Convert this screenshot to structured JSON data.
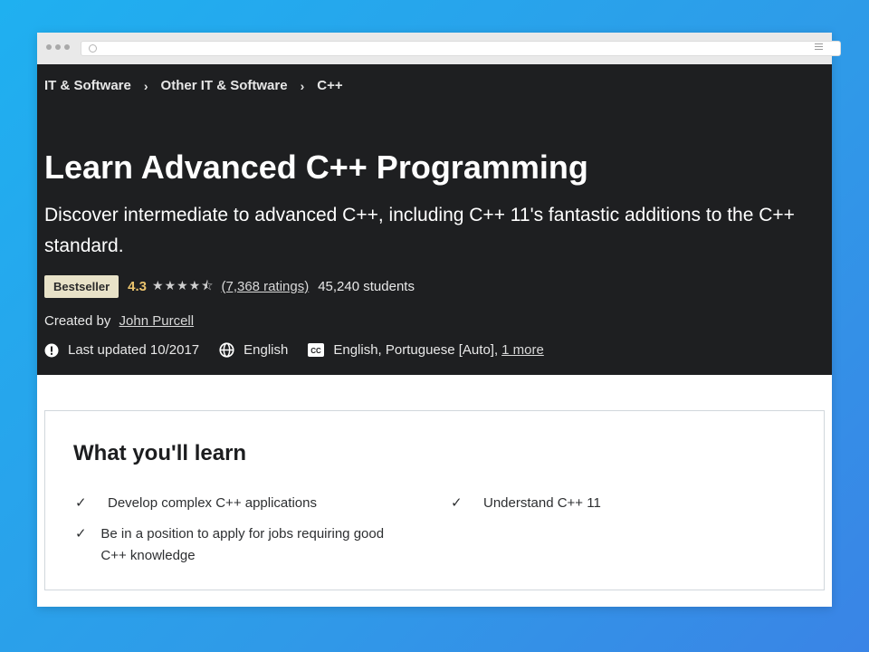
{
  "breadcrumb": [
    "IT & Software",
    "Other IT & Software",
    "C++"
  ],
  "course": {
    "title": "Learn Advanced C++ Programming",
    "subtitle": "Discover intermediate to advanced C++, including C++ 11's fantastic additions to the C++ standard.",
    "badge": "Bestseller",
    "rating": "4.3",
    "ratings_count": "(7,368 ratings)",
    "students": "45,240 students",
    "created_by_label": "Created by",
    "instructor": "John Purcell",
    "last_updated": "Last updated 10/2017",
    "language": "English",
    "captions": "English, Portuguese [Auto],",
    "captions_more": "1 more"
  },
  "learn": {
    "title": "What you'll learn",
    "items": [
      "Develop complex C++ applications",
      "Be in a position to apply for jobs requiring good C++ knowledge",
      "Understand C++ 11"
    ]
  },
  "colors": {
    "hero_bg": "#1e1f21",
    "rating": "#eac36d",
    "badge": "#e8e2c8"
  }
}
